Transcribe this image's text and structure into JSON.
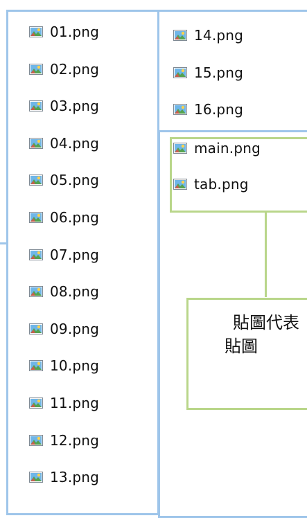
{
  "columns": [
    {
      "files": [
        "01.png",
        "02.png",
        "03.png",
        "04.png",
        "05.png",
        "06.png",
        "07.png",
        "08.png",
        "09.png",
        "10.png",
        "11.png",
        "12.png",
        "13.png"
      ]
    },
    {
      "files": [
        "14.png",
        "15.png",
        "16.png"
      ]
    }
  ],
  "highlighted_files": [
    "main.png",
    "tab.png"
  ],
  "callout": {
    "line1": "貼圖代表",
    "line2": "貼圖"
  },
  "icon_name": "image-file-icon",
  "colors": {
    "blue_outline": "#9ec5ea",
    "green_outline": "#b9d68a",
    "text": "#111111"
  }
}
